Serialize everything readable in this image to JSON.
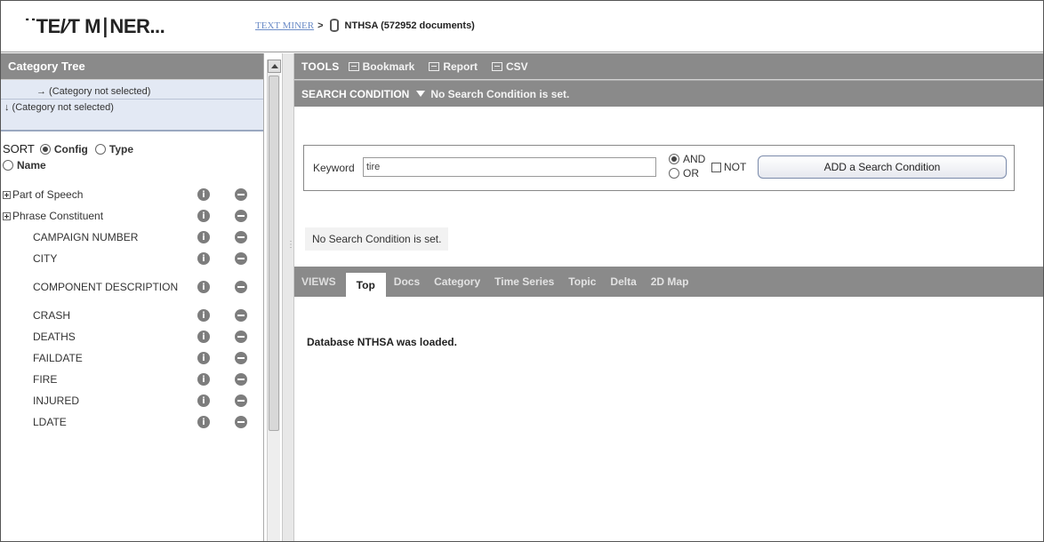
{
  "app": {
    "logo_text": "˙˙TE/∕T M∣NER...",
    "breadcrumb_link": "TEXT MINER",
    "breadcrumb_sep": ">",
    "database_label": "NTHSA (572952 documents)"
  },
  "sidebar": {
    "title": "Category Tree",
    "selection_rows": [
      "→ (Category not selected)",
      "↓ (Category not selected)"
    ],
    "sort_label": "SORT",
    "sort_options": [
      "Config",
      "Type",
      "Name"
    ],
    "sort_selected": "Config",
    "tree_items": [
      {
        "label": "Part of Speech",
        "expandable": true
      },
      {
        "label": "Phrase Constituent",
        "expandable": true
      },
      {
        "label": "CAMPAIGN NUMBER",
        "expandable": false
      },
      {
        "label": "CITY",
        "expandable": false
      },
      {
        "label": "COMPONENT DESCRIPTION",
        "expandable": false
      },
      {
        "label": "CRASH",
        "expandable": false
      },
      {
        "label": "DEATHS",
        "expandable": false
      },
      {
        "label": "FAILDATE",
        "expandable": false
      },
      {
        "label": "FIRE",
        "expandable": false
      },
      {
        "label": "INJURED",
        "expandable": false
      },
      {
        "label": "LDATE",
        "expandable": false
      }
    ],
    "info_icon_glyph": "i"
  },
  "toolbar": {
    "label": "TOOLS",
    "buttons": [
      "Bookmark",
      "Report",
      "CSV"
    ]
  },
  "search": {
    "title": "SEARCH CONDITION",
    "status": "No Search Condition is set.",
    "keyword_label": "Keyword",
    "keyword_value": "tire",
    "and_label": "AND",
    "or_label": "OR",
    "not_label": "NOT",
    "add_button": "ADD a Search Condition",
    "message": "No Search Condition is set."
  },
  "views": {
    "label": "VIEWS",
    "tabs": [
      "Top",
      "Docs",
      "Category",
      "Time Series",
      "Topic",
      "Delta",
      "2D Map"
    ],
    "active_tab": "Top"
  },
  "content": {
    "status_message": "Database NTHSA was loaded."
  },
  "colors": {
    "bar_gray": "#8a8a8a",
    "selection_blue": "#e3e9f4",
    "link_blue": "#6b8cc7"
  }
}
